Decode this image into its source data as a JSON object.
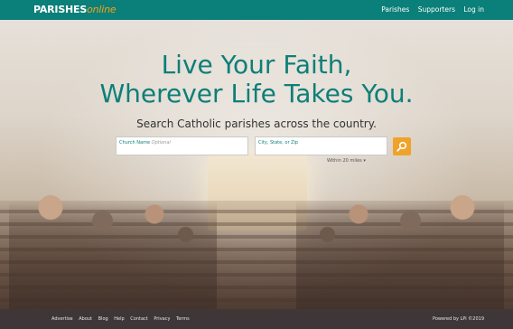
{
  "header": {
    "logo_main": "PARISHES",
    "logo_accent": "online",
    "nav": [
      "Parishes",
      "Supporters",
      "Log in"
    ]
  },
  "hero": {
    "line1": "Live Your Faith,",
    "line2": "Wherever Life Takes You.",
    "subtitle": "Search Catholic parishes across the country."
  },
  "search": {
    "church_label": "Church Name",
    "church_optional": "Optional",
    "location_label": "City, State, or Zip",
    "within": "Within 20 miles",
    "button_icon": "search-icon"
  },
  "footer": {
    "links": [
      "Advertise",
      "About",
      "Blog",
      "Help",
      "Contact",
      "Privacy",
      "Terms"
    ],
    "powered": "Powered by LPi ©2019"
  },
  "colors": {
    "brand": "#0b7f79",
    "accent": "#f5a21a",
    "button": "#f0a32b"
  }
}
